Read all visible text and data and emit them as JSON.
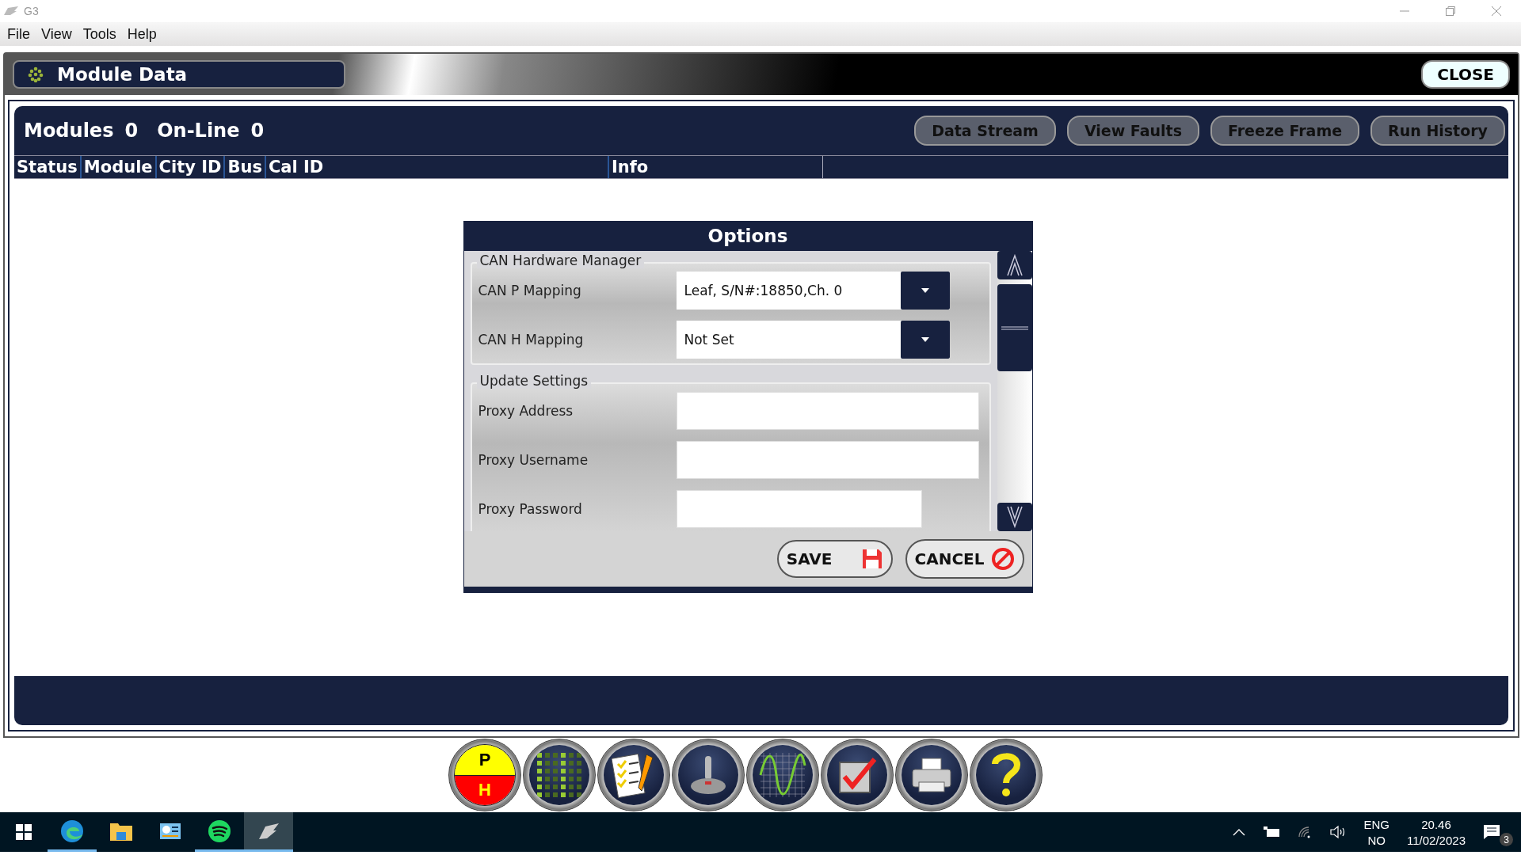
{
  "window": {
    "title": "G3"
  },
  "menu": [
    "File",
    "View",
    "Tools",
    "Help"
  ],
  "header": {
    "title": "Module Data",
    "close": "CLOSE"
  },
  "summary": {
    "modules_label": "Modules",
    "modules": "0",
    "online_label": "On-Line",
    "online": "0"
  },
  "actions": [
    "Data Stream",
    "View Faults",
    "Freeze Frame",
    "Run History"
  ],
  "table": {
    "columns": [
      "Status",
      "Module",
      "City ID",
      "Bus",
      "Cal ID",
      "Info"
    ]
  },
  "dialog": {
    "title": "Options",
    "groups": [
      {
        "title": "CAN Hardware Manager",
        "rows": [
          {
            "kind": "dropdown",
            "label": "CAN P Mapping",
            "value": "Leaf, S/N#:18850,Ch. 0"
          },
          {
            "kind": "dropdown",
            "label": "CAN H Mapping",
            "value": "Not Set"
          }
        ]
      },
      {
        "title": "Update Settings",
        "rows": [
          {
            "kind": "text",
            "label": "Proxy Address"
          },
          {
            "kind": "text",
            "label": "Proxy Username"
          },
          {
            "kind": "password",
            "label": "Proxy Password"
          }
        ]
      }
    ],
    "buttons": [
      {
        "kind": "save",
        "label": "SAVE"
      },
      {
        "kind": "cancel",
        "label": "CANCEL"
      }
    ]
  },
  "toolbar": [
    {
      "kind": "ph",
      "top": "P",
      "bottom": "H"
    },
    {
      "kind": "binary"
    },
    {
      "kind": "checklist"
    },
    {
      "kind": "joystick"
    },
    {
      "kind": "wave"
    },
    {
      "kind": "check"
    },
    {
      "kind": "printer"
    },
    {
      "kind": "help"
    }
  ],
  "taskbar": {
    "apps": [
      {
        "kind": "edge",
        "running": true,
        "selected": false
      },
      {
        "kind": "folder",
        "running": false,
        "selected": false
      },
      {
        "kind": "panel",
        "running": false,
        "selected": false
      },
      {
        "kind": "spotify",
        "running": true,
        "selected": false
      },
      {
        "kind": "g3",
        "running": true,
        "selected": true
      }
    ],
    "language": "ENG",
    "region": "NO",
    "time": "20.46",
    "date": "11/02/2023",
    "notifications": "3"
  }
}
